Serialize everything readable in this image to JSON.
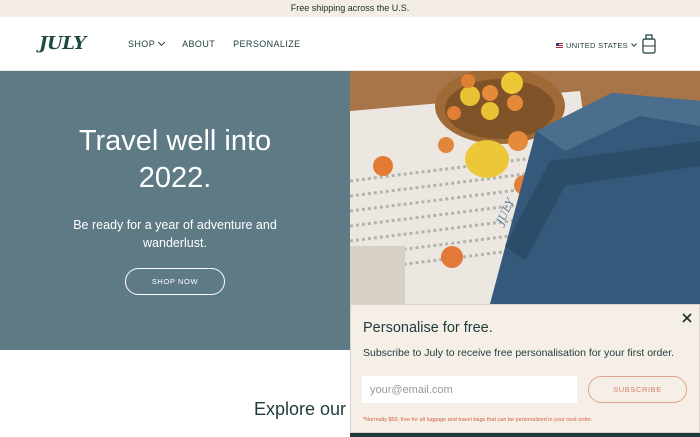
{
  "announcement": "Free shipping across the U.S.",
  "nav": {
    "logo": "JULY",
    "menu": [
      "SHOP",
      "ABOUT",
      "PERSONALIZE"
    ],
    "country": "UNITED STATES"
  },
  "hero": {
    "title_line1": "Travel well into",
    "title_line2": "2022.",
    "subtitle_line1": "Be ready for a year of adventure and",
    "subtitle_line2": "wanderlust.",
    "cta": "SHOP NOW"
  },
  "explore_heading": "Explore our",
  "popup": {
    "title": "Personalise for free.",
    "description": "Subscribe to July to receive free personalisation for your first order.",
    "email_placeholder": "your@email.com",
    "subscribe_label": "SUBSCRIBE",
    "fine_print": "*Normally $50, free for all luggage and travel bags that can be personalized in your next order."
  },
  "colors": {
    "announcement_bg": "#f3ede5",
    "hero_bg": "#5e7a85",
    "brand_dark": "#1d3b3a",
    "popup_bg": "#f5efe8",
    "accent": "#d58063"
  },
  "icons": [
    "chevron-down-icon",
    "us-flag-icon",
    "shopping-bag-icon",
    "close-icon"
  ]
}
